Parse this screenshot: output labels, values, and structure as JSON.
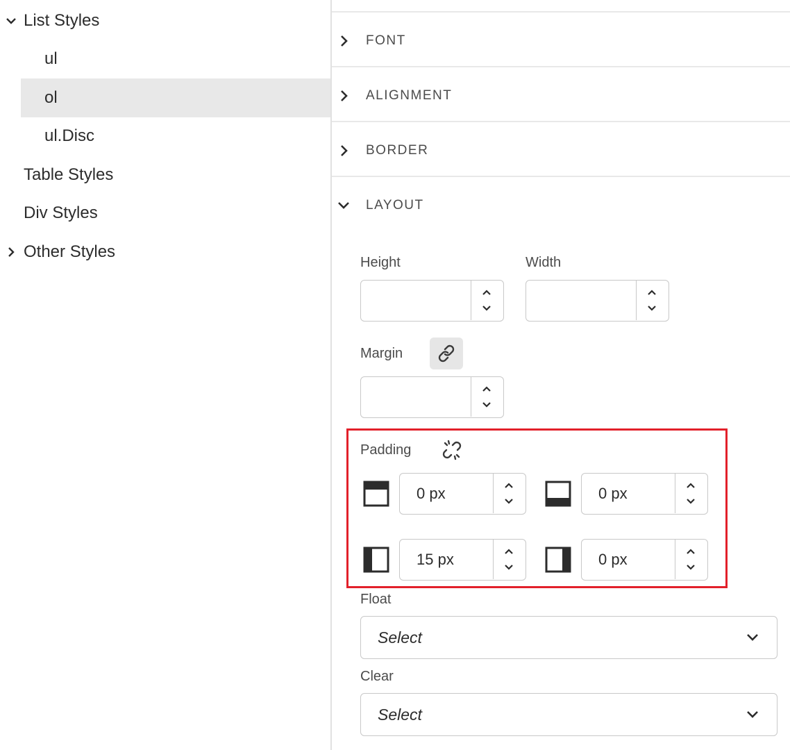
{
  "tree": {
    "items": [
      {
        "label": "List Styles",
        "expanded": true
      },
      {
        "label": "ul"
      },
      {
        "label": "ol",
        "selected": true
      },
      {
        "label": "ul.Disc"
      },
      {
        "label": "Table Styles"
      },
      {
        "label": "Div Styles"
      },
      {
        "label": "Other Styles",
        "expanded": false
      }
    ]
  },
  "sections": {
    "font": {
      "label": "FONT",
      "expanded": false
    },
    "alignment": {
      "label": "ALIGNMENT",
      "expanded": false
    },
    "border": {
      "label": "BORDER",
      "expanded": false
    },
    "layout": {
      "label": "LAYOUT",
      "expanded": true
    }
  },
  "layout": {
    "height": {
      "label": "Height",
      "value": ""
    },
    "width": {
      "label": "Width",
      "value": ""
    },
    "margin": {
      "label": "Margin",
      "value": "",
      "linked": true,
      "link_icon": "link-icon"
    },
    "padding": {
      "label": "Padding",
      "linked": false,
      "link_icon": "unlink-icon",
      "top": "0 px",
      "bottom": "0 px",
      "left": "15 px",
      "right": "0 px"
    },
    "float": {
      "label": "Float",
      "placeholder": "Select"
    },
    "clear": {
      "label": "Clear",
      "placeholder": "Select"
    }
  },
  "colors": {
    "highlight": "#e2202a",
    "selected_row": "#e8e8e8"
  }
}
